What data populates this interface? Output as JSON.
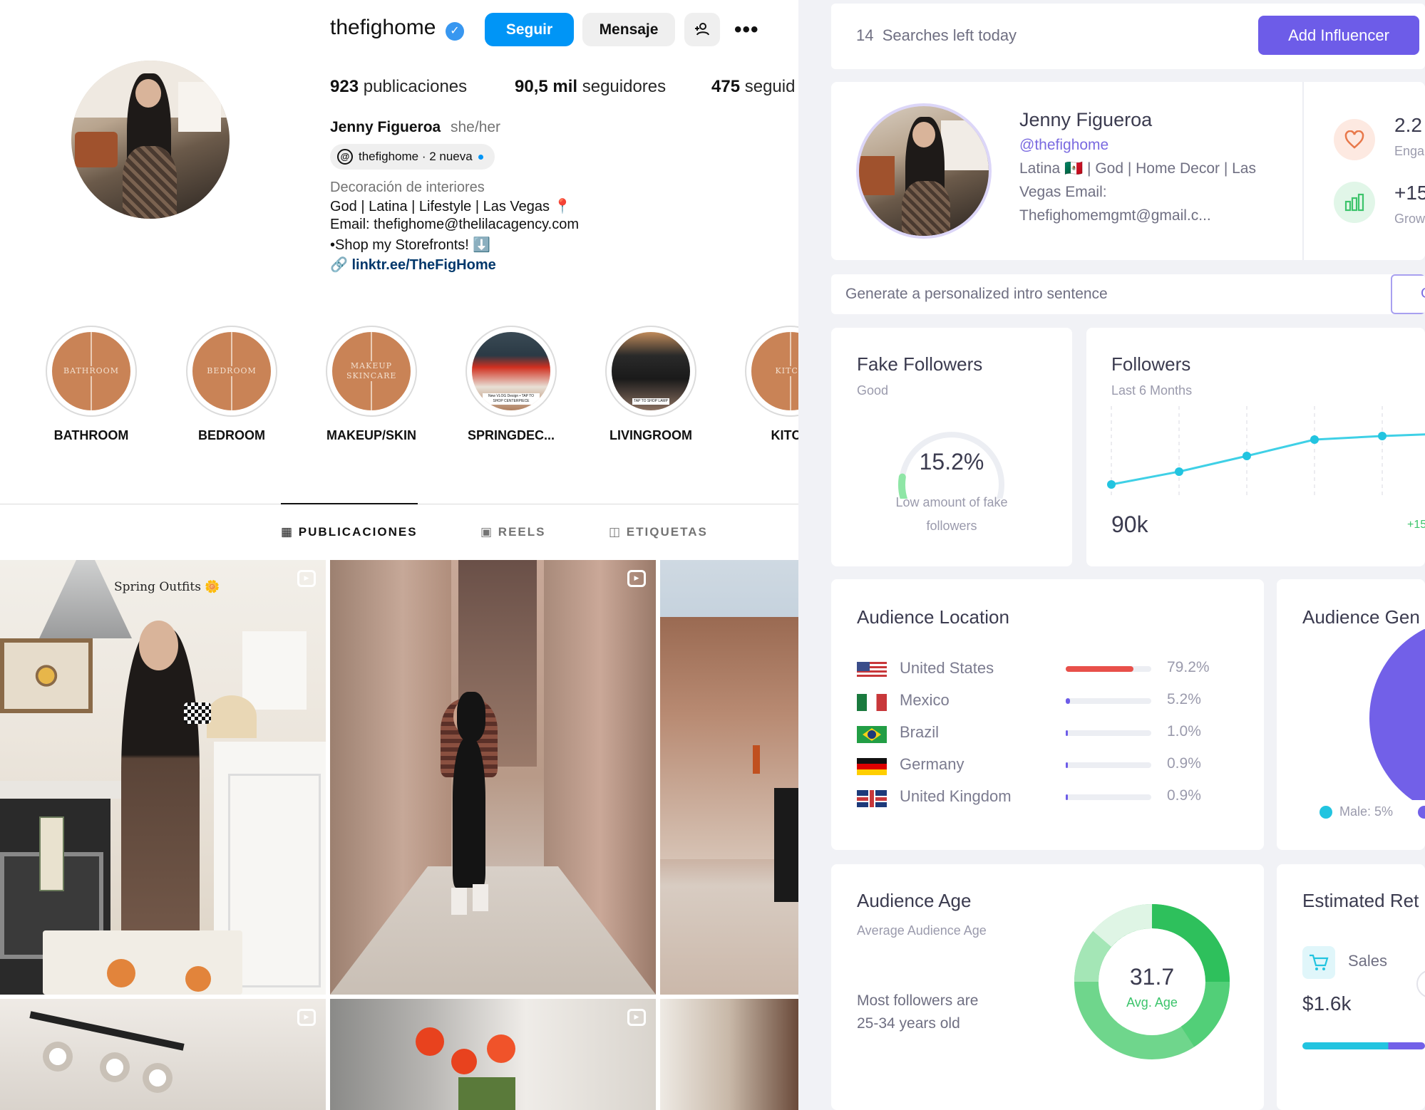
{
  "instagram": {
    "username": "thefighome",
    "buttons": {
      "follow": "Seguir",
      "message": "Mensaje",
      "add_user_icon": "add-user-icon",
      "more_icon": "more-icon"
    },
    "stats": [
      {
        "num": "923",
        "label": "publicaciones"
      },
      {
        "num": "90,5 mil",
        "label": "seguidores"
      },
      {
        "num": "475",
        "label": "seguid"
      }
    ],
    "full_name": "Jenny Figueroa",
    "pronouns": "she/her",
    "threads_pill": "thefighome · 2 nueva",
    "category": "Decoración de interiores",
    "bio": [
      "God | Latina | Lifestyle | Las Vegas 📍",
      "Email: thefighome@thelilacagency.com",
      "•Shop my Storefronts! ⬇️"
    ],
    "link": "linktr.ee/TheFigHome",
    "highlights": [
      {
        "label": "BATHROOM",
        "cover_text": "BATHROOM"
      },
      {
        "label": "BEDROOM",
        "cover_text": "BEDROOM"
      },
      {
        "label": "MAKEUP/SKIN",
        "cover_text": "MAKEUP SKINCARE"
      },
      {
        "label": "SPRINGDEC...",
        "cover_text": "New VLOG Design • TAP TO SHOP CENTERPIECE"
      },
      {
        "label": "LIVINGROOM",
        "cover_text": "TAP TO SHOP LAMP"
      },
      {
        "label": "KITCH",
        "cover_text": "KITCH"
      }
    ],
    "tabs": [
      "PUBLICACIONES",
      "REELS",
      "ETIQUETAS"
    ],
    "posts": [
      {
        "caption": "Spring Outfits 🌼"
      }
    ]
  },
  "dashboard": {
    "searches": {
      "count": "14",
      "label": "Searches left today"
    },
    "add_button": "Add Influencer",
    "profile": {
      "name": "Jenny Figueroa",
      "handle": "@thefighome",
      "bio_line1": "Latina 🇲🇽 | God | Home Decor | Las",
      "bio_line2": "Vegas Email:",
      "bio_line3": "Thefighomemgmt@gmail.c..."
    },
    "metrics": [
      {
        "value": "2.2",
        "label": "Enga",
        "icon": "heart-icon",
        "color": "#e8784a"
      },
      {
        "value": "+15",
        "label": "Grow",
        "icon": "bar-chart-icon",
        "color": "#3cc46b"
      }
    ],
    "intro_placeholder": "Generate a personalized intro sentence",
    "intro_button": "G",
    "fake_followers": {
      "title": "Fake Followers",
      "status": "Good",
      "value": "15.2%",
      "fraction": 0.152,
      "note_line1": "Low amount of fake",
      "note_line2": "followers"
    },
    "followers": {
      "title": "Followers",
      "subtitle": "Last 6 Months",
      "current": "90k",
      "growth": "+15"
    },
    "audience_location": {
      "title": "Audience Location",
      "rows": [
        {
          "country": "United States",
          "pct": "79.2%",
          "value": 79.2,
          "color": "#e8504a",
          "flag": "us-flag-icon"
        },
        {
          "country": "Mexico",
          "pct": "5.2%",
          "value": 5.2,
          "color": "#6d5ce8",
          "flag": "mexico-flag-icon"
        },
        {
          "country": "Brazil",
          "pct": "1.0%",
          "value": 1.0,
          "color": "#6d5ce8",
          "flag": "brazil-flag-icon"
        },
        {
          "country": "Germany",
          "pct": "0.9%",
          "value": 0.9,
          "color": "#6d5ce8",
          "flag": "germany-flag-icon"
        },
        {
          "country": "United Kingdom",
          "pct": "0.9%",
          "value": 0.9,
          "color": "#6d5ce8",
          "flag": "uk-flag-icon"
        }
      ]
    },
    "audience_gender": {
      "title": "Audience Gen",
      "legend_male": "Male: 5%",
      "male_fraction": 0.05,
      "colors": {
        "male": "#22c4e0",
        "female": "#7260e8"
      }
    },
    "audience_age": {
      "title": "Audience Age",
      "subtitle": "Average Audience Age",
      "note_line1": "Most followers are",
      "note_line2": "25-34 years old",
      "value": "31.7",
      "value_label": "Avg. Age"
    },
    "estimated": {
      "title": "Estimated Ret",
      "sales_label": "Sales",
      "sales_value": "$1.6k",
      "icon": "cart-icon"
    }
  },
  "chart_data": [
    {
      "type": "line",
      "title": "Followers",
      "subtitle": "Last 6 Months",
      "x": [
        1,
        2,
        3,
        4,
        5
      ],
      "y": [
        0.05,
        0.23,
        0.45,
        0.68,
        0.73
      ]
    }
  ]
}
